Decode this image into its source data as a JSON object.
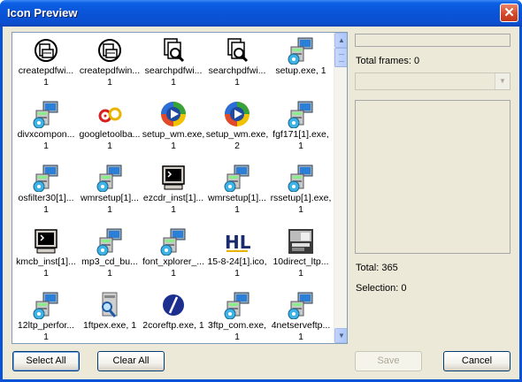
{
  "window": {
    "title": "Icon Preview",
    "close_glyph": "✕"
  },
  "icons": [
    {
      "label": "createpdfwi...",
      "count": "1",
      "icon": "pdf-printer-icon"
    },
    {
      "label": "createpdfwin...",
      "count": "1",
      "icon": "pdf-printer-icon"
    },
    {
      "label": "searchpdfwi...",
      "count": "1",
      "icon": "pdf-search-icon"
    },
    {
      "label": "searchpdfwi...",
      "count": "1",
      "icon": "pdf-search-icon"
    },
    {
      "label": "setup.exe, 1",
      "count": "",
      "icon": "installer-icon"
    },
    {
      "label": "divxcompon...",
      "count": "1",
      "icon": "installer-icon"
    },
    {
      "label": "googletoolba...",
      "count": "1",
      "icon": "google-toolbar-icon"
    },
    {
      "label": "setup_wm.exe,",
      "count": "1",
      "icon": "media-player-icon"
    },
    {
      "label": "setup_wm.exe,",
      "count": "2",
      "icon": "media-player-icon"
    },
    {
      "label": "fgf171[1].exe,",
      "count": "1",
      "icon": "installer-icon"
    },
    {
      "label": "osfilter30[1]...",
      "count": "1",
      "icon": "installer-icon"
    },
    {
      "label": "wmrsetup[1]...",
      "count": "1",
      "icon": "installer-icon"
    },
    {
      "label": "ezcdr_inst[1]...",
      "count": "1",
      "icon": "terminal-icon"
    },
    {
      "label": "wmrsetup[1]...",
      "count": "1",
      "icon": "installer-icon"
    },
    {
      "label": "rssetup[1].exe,",
      "count": "1",
      "icon": "installer-icon"
    },
    {
      "label": "kmcb_inst[1]...",
      "count": "1",
      "icon": "terminal-icon"
    },
    {
      "label": "mp3_cd_bu...",
      "count": "1",
      "icon": "installer-icon"
    },
    {
      "label": "font_xplorer_...",
      "count": "1",
      "icon": "installer-icon"
    },
    {
      "label": "15-8-24[1].ico,",
      "count": "1",
      "icon": "hl-logo-icon"
    },
    {
      "label": "10direct_ltp...",
      "count": "1",
      "icon": "image-thumbnail-icon"
    },
    {
      "label": "12ltp_perfor...",
      "count": "1",
      "icon": "installer-icon"
    },
    {
      "label": "1ftpex.exe, 1",
      "count": "",
      "icon": "ftp-search-icon"
    },
    {
      "label": "2coreftp.exe, 1",
      "count": "",
      "icon": "coreftp-icon"
    },
    {
      "label": "3ftp_com.exe,",
      "count": "1",
      "icon": "installer-icon"
    },
    {
      "label": "4netserveftp...",
      "count": "1",
      "icon": "installer-icon"
    }
  ],
  "scrollbar": {
    "up_glyph": "▲",
    "down_glyph": "▼"
  },
  "info": {
    "total_frames": "Total frames: 0",
    "total": "Total: 365",
    "selection": "Selection: 0",
    "dropdown_arrow": "▼"
  },
  "buttons": {
    "select_all": "Select All",
    "clear_all": "Clear All",
    "save": "Save",
    "cancel": "Cancel"
  },
  "colors": {
    "title_bar": "#0a54d8",
    "dialog_bg": "#ece9d8",
    "list_border": "#7f9db9"
  }
}
